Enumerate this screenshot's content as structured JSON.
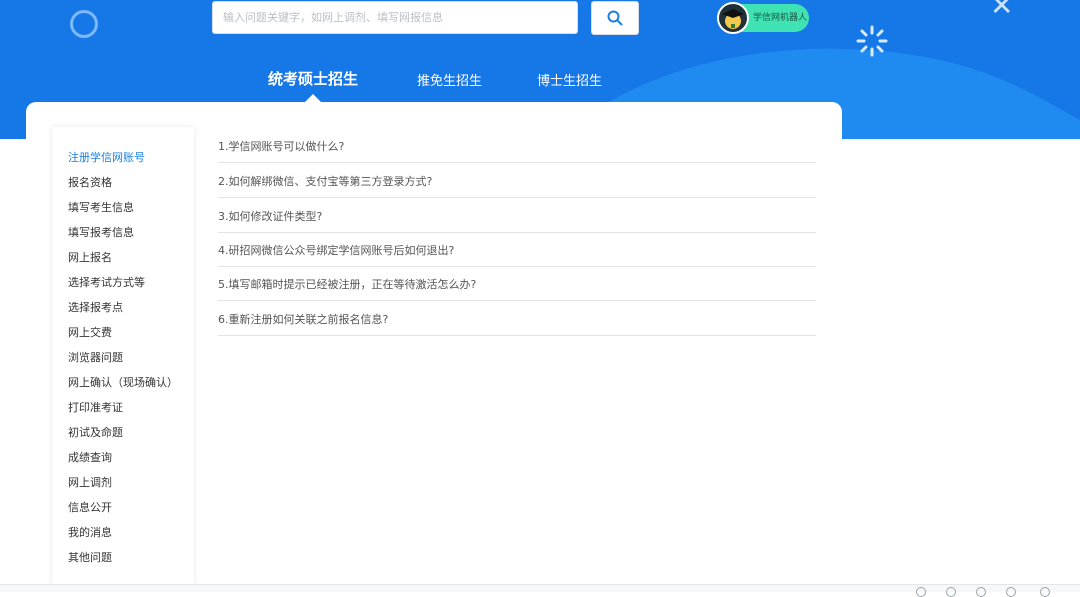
{
  "search": {
    "placeholder": "输入问题关键字，如网上调剂、填写网报信息",
    "button_icon": "search-icon"
  },
  "robot": {
    "label": "学信网机器人",
    "icon": "graduate-avatar-icon"
  },
  "tabs": [
    {
      "label": "统考硕士招生",
      "active": true
    },
    {
      "label": "推免生招生",
      "active": false
    },
    {
      "label": "博士生招生",
      "active": false
    }
  ],
  "sidebar": {
    "items": [
      {
        "label": "注册学信网账号",
        "active": true
      },
      {
        "label": "报名资格"
      },
      {
        "label": "填写考生信息"
      },
      {
        "label": "填写报考信息"
      },
      {
        "label": "网上报名"
      },
      {
        "label": "选择考试方式等"
      },
      {
        "label": "选择报考点"
      },
      {
        "label": "网上交费"
      },
      {
        "label": "浏览器问题"
      },
      {
        "label": "网上确认（现场确认）"
      },
      {
        "label": "打印准考证"
      },
      {
        "label": "初试及命题"
      },
      {
        "label": "成绩查询"
      },
      {
        "label": "网上调剂"
      },
      {
        "label": "信息公开"
      },
      {
        "label": "我的消息"
      },
      {
        "label": "其他问题"
      }
    ]
  },
  "faq": [
    {
      "text": "1.学信网账号可以做什么?"
    },
    {
      "text": "2.如何解绑微信、支付宝等第三方登录方式?"
    },
    {
      "text": "3.如何修改证件类型?"
    },
    {
      "text": "4.研招网微信公众号绑定学信网账号后如何退出?"
    },
    {
      "text": "5.填写邮箱时提示已经被注册，正在等待激活怎么办?"
    },
    {
      "text": "6.重新注册如何关联之前报名信息?"
    }
  ],
  "colors": {
    "header_blue": "#1677e6",
    "active_blue": "#1b7fe0",
    "robot_green": "#3fe3b3"
  }
}
